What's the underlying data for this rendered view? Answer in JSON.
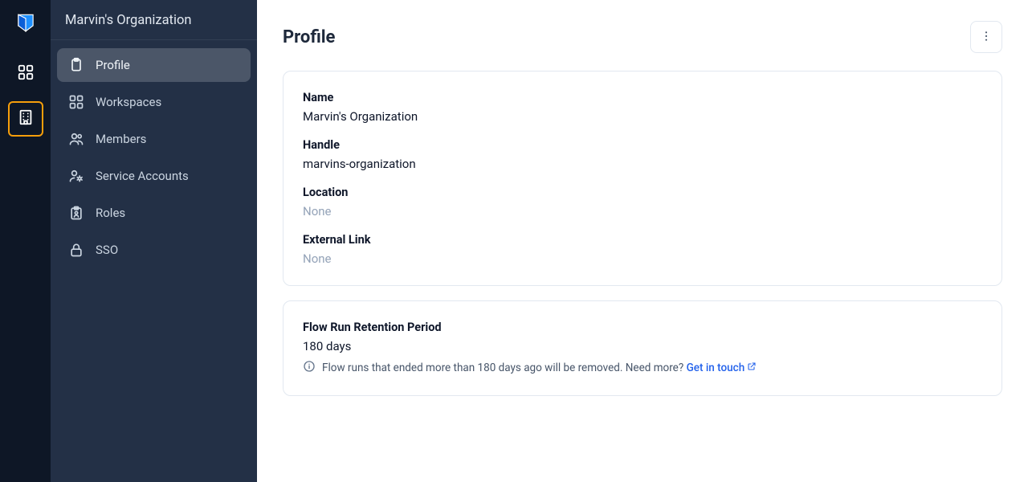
{
  "org_name": "Marvin's Organization",
  "rail": {
    "items": [
      {
        "name": "workspaces-icon",
        "active": false
      },
      {
        "name": "organization-icon",
        "active": true
      }
    ]
  },
  "sidebar": {
    "title": "Marvin's Organization",
    "items": [
      {
        "label": "Profile",
        "icon": "clipboard-icon",
        "active": true
      },
      {
        "label": "Workspaces",
        "icon": "grid-icon",
        "active": false
      },
      {
        "label": "Members",
        "icon": "users-icon",
        "active": false
      },
      {
        "label": "Service Accounts",
        "icon": "gear-user-icon",
        "active": false
      },
      {
        "label": "Roles",
        "icon": "id-badge-icon",
        "active": false
      },
      {
        "label": "SSO",
        "icon": "lock-icon",
        "active": false
      }
    ]
  },
  "page": {
    "title": "Profile"
  },
  "profile": {
    "fields": [
      {
        "label": "Name",
        "value": "Marvin's Organization",
        "none": false
      },
      {
        "label": "Handle",
        "value": "marvins-organization",
        "none": false
      },
      {
        "label": "Location",
        "value": "None",
        "none": true
      },
      {
        "label": "External Link",
        "value": "None",
        "none": true
      }
    ]
  },
  "retention": {
    "title": "Flow Run Retention Period",
    "value": "180 days",
    "info_text": "Flow runs that ended more than 180 days ago will be removed. Need more? ",
    "link_text": "Get in touch"
  }
}
